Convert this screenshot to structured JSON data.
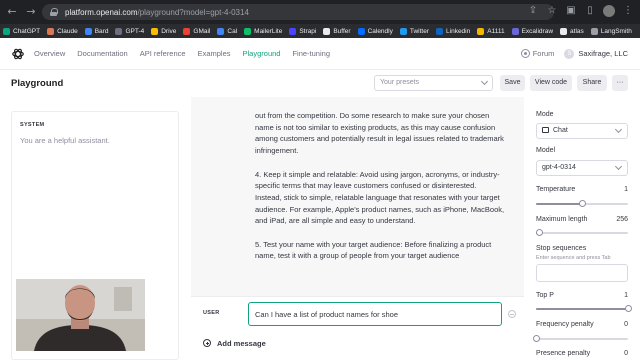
{
  "browser": {
    "url_host": "platform.openai.com",
    "url_path": "/playground?model=gpt-4-0314",
    "bookmarks": [
      {
        "label": "ChatGPT",
        "color": "#10a37f"
      },
      {
        "label": "Claude",
        "color": "#d97757"
      },
      {
        "label": "Bard",
        "color": "#4285f4"
      },
      {
        "label": "GPT-4",
        "color": "#6e6e80"
      },
      {
        "label": "Drive",
        "color": "#fbbc04"
      },
      {
        "label": "GMail",
        "color": "#ea4335"
      },
      {
        "label": "Cal",
        "color": "#4285f4"
      },
      {
        "label": "MailerLite",
        "color": "#09c269"
      },
      {
        "label": "Strapi",
        "color": "#4945ff"
      },
      {
        "label": "Buffer",
        "color": "#e8eaed"
      },
      {
        "label": "Calendly",
        "color": "#006bff"
      },
      {
        "label": "Twitter",
        "color": "#1d9bf0"
      },
      {
        "label": "Linkedin",
        "color": "#0a66c2"
      },
      {
        "label": "A1111",
        "color": "#f4b400"
      },
      {
        "label": "Excalidraw",
        "color": "#6965db"
      },
      {
        "label": "atlas",
        "color": "#e8eaed"
      },
      {
        "label": "LangSmith",
        "color": "#9aa0a6"
      }
    ]
  },
  "nav": {
    "items": [
      "Overview",
      "Documentation",
      "API reference",
      "Examples",
      "Playground",
      "Fine-tuning"
    ],
    "active": "Playground",
    "forum": "Forum",
    "org": "Saxifrage, LLC",
    "org_initial": "S"
  },
  "toolbar": {
    "title": "Playground",
    "presets_placeholder": "Your presets",
    "save": "Save",
    "view_code": "View code",
    "share": "Share",
    "more": "···"
  },
  "system": {
    "label": "SYSTEM",
    "text": "You are a helpful assistant."
  },
  "chat": {
    "assistant_paragraphs": [
      "out from the competition. Do some research to make sure your chosen name is not too similar to existing products, as this may cause confusion among customers and potentially result in legal issues related to trademark infringement.",
      "4. Keep it simple and relatable: Avoid using jargon, acronyms, or industry-specific terms that may leave customers confused or disinterested. Instead, stick to simple, relatable language that resonates with your target audience. For example, Apple's product names, such as iPhone, MacBook, and iPad, are all simple and easy to understand.",
      "5. Test your name with your target audience: Before finalizing a product name, test it with a group of people from your target audience"
    ],
    "user_label": "USER",
    "user_input": "Can I have a list of product names for shoe",
    "add_message": "Add message"
  },
  "settings": {
    "mode_label": "Mode",
    "mode_value": "Chat",
    "model_label": "Model",
    "model_value": "gpt-4-0314",
    "temperature_label": "Temperature",
    "temperature_value": "1",
    "temperature_fraction": 0.5,
    "max_length_label": "Maximum length",
    "max_length_value": "256",
    "max_length_fraction": 0.03,
    "stop_label": "Stop sequences",
    "stop_hint": "Enter sequence and press Tab",
    "top_p_label": "Top P",
    "top_p_value": "1",
    "top_p_fraction": 1.0,
    "freq_label": "Frequency penalty",
    "freq_value": "0",
    "freq_fraction": 0.0,
    "presence_label": "Presence penalty",
    "presence_value": "0"
  }
}
